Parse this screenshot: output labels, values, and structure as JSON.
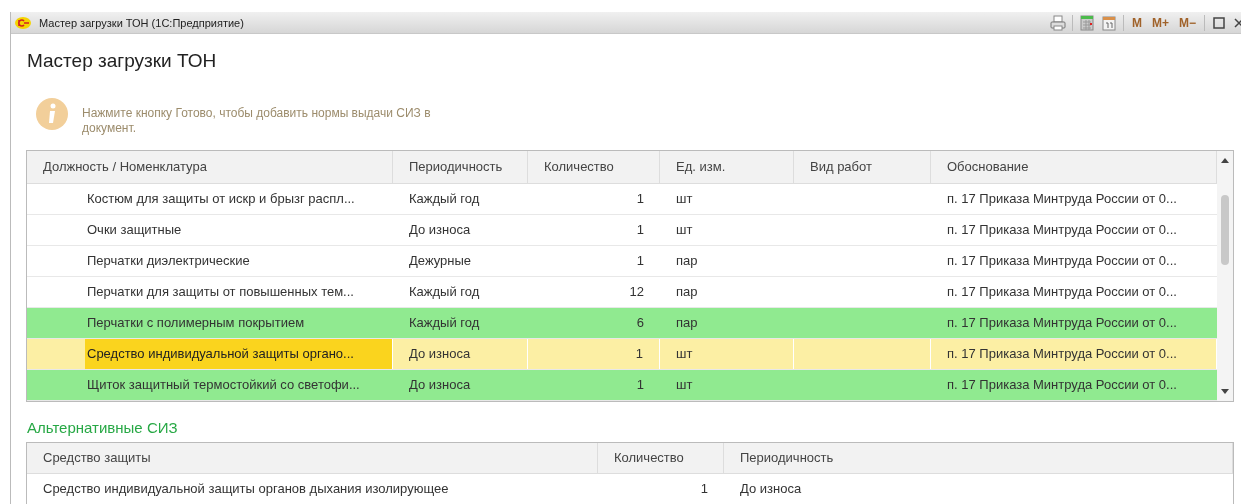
{
  "window": {
    "title": "Мастер загрузки ТОН  (1С:Предприятие)",
    "memory_buttons": [
      "M",
      "M+",
      "M−"
    ]
  },
  "heading": "Мастер загрузки ТОН",
  "info": "Нажмите кнопку Готово, чтобы добавить нормы выдачи СИЗ в документ.",
  "table": {
    "columns": [
      "Должность / Номенклатура",
      "Периодичность",
      "Количество",
      "Ед. изм.",
      "Вид работ",
      "Обоснование"
    ],
    "rows": [
      {
        "kind": "normal",
        "selected": false,
        "cells": [
          "Костюм для защиты от искр и брызг распл...",
          "Каждый год",
          "1",
          "шт",
          null,
          "п. 17 Приказа Минтруда России от 0..."
        ]
      },
      {
        "kind": "normal",
        "selected": false,
        "cells": [
          "Очки защитные",
          "До износа",
          "1",
          "шт",
          null,
          "п. 17 Приказа Минтруда России от 0..."
        ]
      },
      {
        "kind": "normal",
        "selected": false,
        "cells": [
          "Перчатки диэлектрические",
          "Дежурные",
          "1",
          "пар",
          null,
          "п. 17 Приказа Минтруда России от 0..."
        ]
      },
      {
        "kind": "normal",
        "selected": false,
        "cells": [
          "Перчатки для защиты от повышенных тем...",
          "Каждый год",
          "12",
          "пар",
          null,
          "п. 17 Приказа Минтруда России от 0..."
        ]
      },
      {
        "kind": "marked",
        "selected": false,
        "cells": [
          "Перчатки с полимерным покрытием",
          "Каждый год",
          "6",
          "пар",
          null,
          "п. 17 Приказа Минтруда России от 0..."
        ]
      },
      {
        "kind": "normal",
        "selected": true,
        "cells": [
          "Средство индивидуальной защиты органо...",
          "До износа",
          "1",
          "шт",
          null,
          "п. 17 Приказа Минтруда России от 0..."
        ]
      },
      {
        "kind": "marked",
        "selected": false,
        "cells": [
          "Щиток защитный термостойкий со светофи...",
          "До износа",
          "1",
          "шт",
          null,
          "п. 17 Приказа Минтруда России от 0..."
        ]
      }
    ]
  },
  "alternatives": {
    "title": "Альтернативные СИЗ",
    "columns": [
      "Средство защиты",
      "Количество",
      "Периодичность"
    ],
    "rows": [
      {
        "cells": [
          "Средство индивидуальной защиты органов дыхания изолирующее",
          "1",
          "До износа"
        ]
      }
    ]
  }
}
